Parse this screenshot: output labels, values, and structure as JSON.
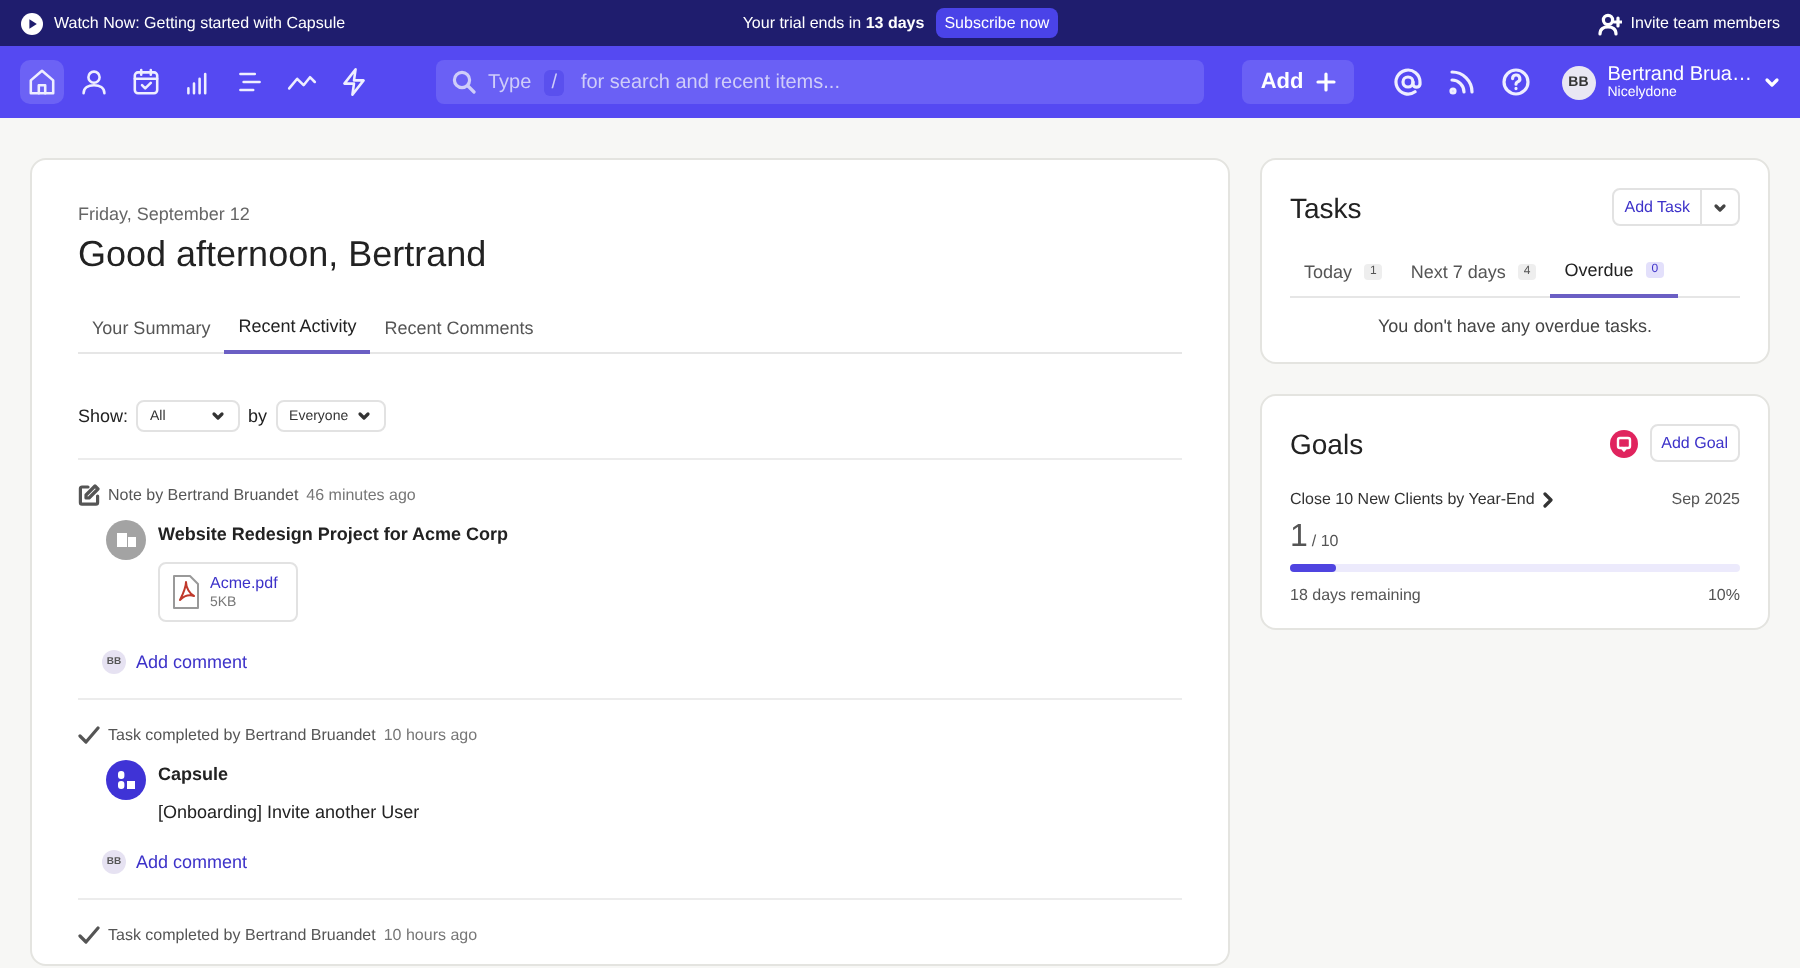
{
  "banner": {
    "watch_label": "Watch Now: Getting started with Capsule",
    "trial_text": "Your trial ends in **13 days**",
    "subscribe": "Subscribe now",
    "invite": "Invite team members"
  },
  "nav": {
    "items": [
      {
        "kind": "home",
        "selected": true
      },
      {
        "kind": "person",
        "selected": false
      },
      {
        "kind": "calendar",
        "selected": false
      },
      {
        "kind": "bars",
        "selected": false
      },
      {
        "kind": "list",
        "selected": false
      },
      {
        "kind": "trend",
        "selected": false
      },
      {
        "kind": "bolt",
        "selected": false
      }
    ],
    "search": {
      "prefix": "Type",
      "key": "/",
      "placeholder": "for search and recent items..."
    },
    "add_button": "Add",
    "user": {
      "initials": "BB",
      "name": "Bertrand Brua…",
      "org": "Nicelydone"
    }
  },
  "main": {
    "date": "Friday, September 12",
    "greeting": "Good afternoon, Bertrand",
    "tabs": [
      {
        "label": "Your Summary",
        "selected": false
      },
      {
        "label": "Recent Activity",
        "selected": true
      },
      {
        "label": "Recent Comments",
        "selected": false
      }
    ],
    "filter": {
      "show_label": "Show:",
      "show_value": "All",
      "by_label": "by",
      "by_value": "Everyone"
    },
    "activities": [
      {
        "kind": "note",
        "meta": "Note by Bertrand Bruandet",
        "time": "46 minutes ago",
        "title": "Website Redesign Project for Acme Corp",
        "attachment": {
          "name": "Acme.pdf",
          "size": "5KB"
        },
        "comment_initials": "BB",
        "comment_label": "Add comment"
      },
      {
        "kind": "task",
        "meta": "Task completed by Bertrand Bruandet",
        "time": "10 hours ago",
        "title": "Capsule",
        "body": "[Onboarding] Invite another User",
        "comment_initials": "BB",
        "comment_label": "Add comment"
      },
      {
        "kind": "task",
        "meta": "Task completed by Bertrand Bruandet",
        "time": "10 hours ago"
      }
    ]
  },
  "tasks": {
    "title": "Tasks",
    "add_button": "Add Task",
    "tabs": [
      {
        "label": "Today",
        "count": "1",
        "selected": false
      },
      {
        "label": "Next 7 days",
        "count": "4",
        "selected": false
      },
      {
        "label": "Overdue",
        "count": "0",
        "selected": true
      }
    ],
    "empty_text": "You don't have any overdue tasks."
  },
  "goals": {
    "title": "Goals",
    "add_button": "Add Goal",
    "goal": {
      "name": "Close 10 New Clients by Year-End",
      "date": "Sep 2025",
      "current": "1",
      "target": "/ 10",
      "level": 0.1,
      "remaining": "18 days remaining",
      "percent": "10%"
    }
  }
}
